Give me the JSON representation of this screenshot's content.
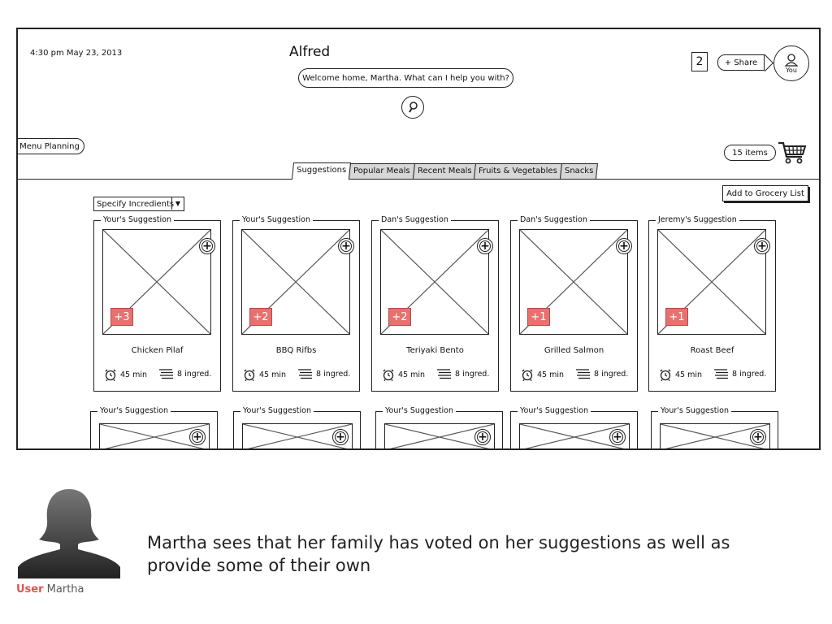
{
  "header": {
    "datetime": "4:30 pm May 23, 2013",
    "assistant_name": "Alfred",
    "assistant_message": "Welcome home, Martha. What can I help you with?",
    "notification_count": "2",
    "share_label": "+ Share",
    "profile_label": "You"
  },
  "nav": {
    "menu_label": "Menu Planning",
    "cart_count_label": "15 items",
    "tabs": [
      {
        "label": "Suggestions",
        "active": true
      },
      {
        "label": "Popular Meals"
      },
      {
        "label": "Recent Meals"
      },
      {
        "label": "Fruits & Vegetables"
      },
      {
        "label": "Snacks"
      }
    ]
  },
  "toolbar": {
    "specify_label": "Specify Incredients",
    "add_grocery_label": "Add to Grocery List"
  },
  "cards": [
    {
      "label": "Your's Suggestion",
      "votes": "+3",
      "name": "Chicken Pilaf",
      "time": "45 min",
      "ingredients": "8 ingred."
    },
    {
      "label": "Your's Suggestion",
      "votes": "+2",
      "name": "BBQ Rifbs",
      "time": "45 min",
      "ingredients": "8 ingred."
    },
    {
      "label": "Dan's Suggestion",
      "votes": "+2",
      "name": "Teriyaki Bento",
      "time": "45 min",
      "ingredients": "8 ingred."
    },
    {
      "label": "Dan's Suggestion",
      "votes": "+1",
      "name": "Grilled Salmon",
      "time": "45 min",
      "ingredients": "8 ingred."
    },
    {
      "label": "Jeremy's Suggestion",
      "votes": "+1",
      "name": "Roast Beef",
      "time": "45 min",
      "ingredients": "8 ingred."
    }
  ],
  "cards_row2": [
    {
      "label": "Your's Suggestion"
    },
    {
      "label": "Your's Suggestion"
    },
    {
      "label": "Your's Suggestion"
    },
    {
      "label": "Your's Suggestion"
    },
    {
      "label": "Your's Suggestion"
    }
  ],
  "caption": {
    "text": "Martha sees that her family has voted on her suggestions as well as provide some of their own",
    "user_role": "User",
    "user_name": "Martha"
  },
  "colors": {
    "vote_badge": "#e8716f",
    "user_role": "#e0534f"
  }
}
